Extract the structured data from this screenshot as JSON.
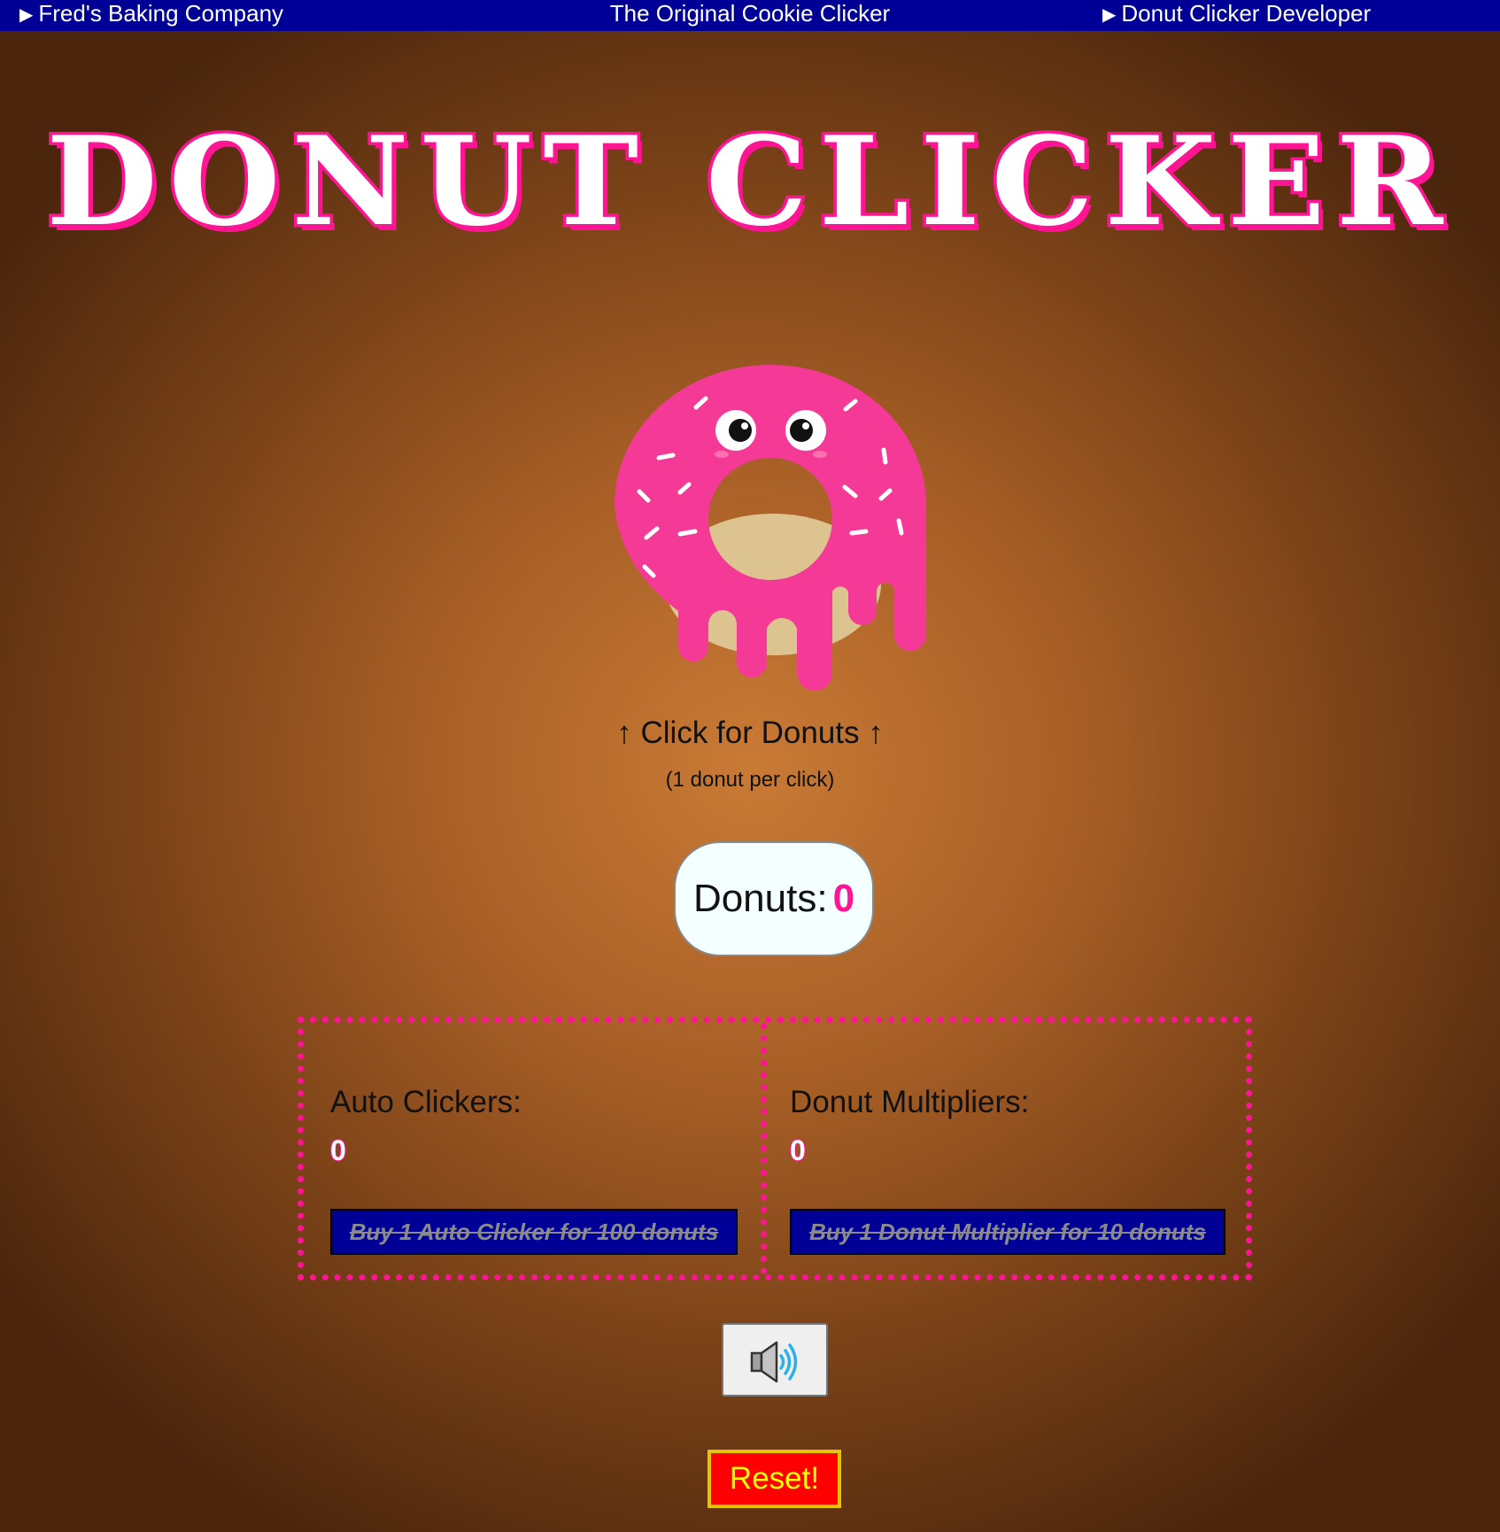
{
  "colors": {
    "nav_bar": "#000096",
    "accent_pink": "#ff1493",
    "donut_frosting": "#f43a96",
    "reset_background": "#ff0000",
    "reset_text": "#ffff00"
  },
  "nav": {
    "left_link": "Fred's Baking Company",
    "center_link": "The Original Cookie Clicker",
    "right_link": "Donut Clicker Developer",
    "expand_icon": "triangle-right-icon"
  },
  "title": "DONUT CLICKER",
  "donut": {
    "icon": "donut-icon",
    "hint": "↑ Click for Donuts ↑",
    "per_click": "(1 donut per click)"
  },
  "counter": {
    "label": "Donuts:",
    "value": "0"
  },
  "shop": {
    "auto_clickers": {
      "label": "Auto Clickers:",
      "count": "0",
      "buy_label": "Buy 1 Auto Clicker for 100 donuts"
    },
    "multipliers": {
      "label": "Donut Multipliers:",
      "count": "0",
      "buy_label": "Buy 1 Donut Multiplier for 10 donuts"
    }
  },
  "sound": {
    "icon": "speaker-icon"
  },
  "reset_label": "Reset!"
}
